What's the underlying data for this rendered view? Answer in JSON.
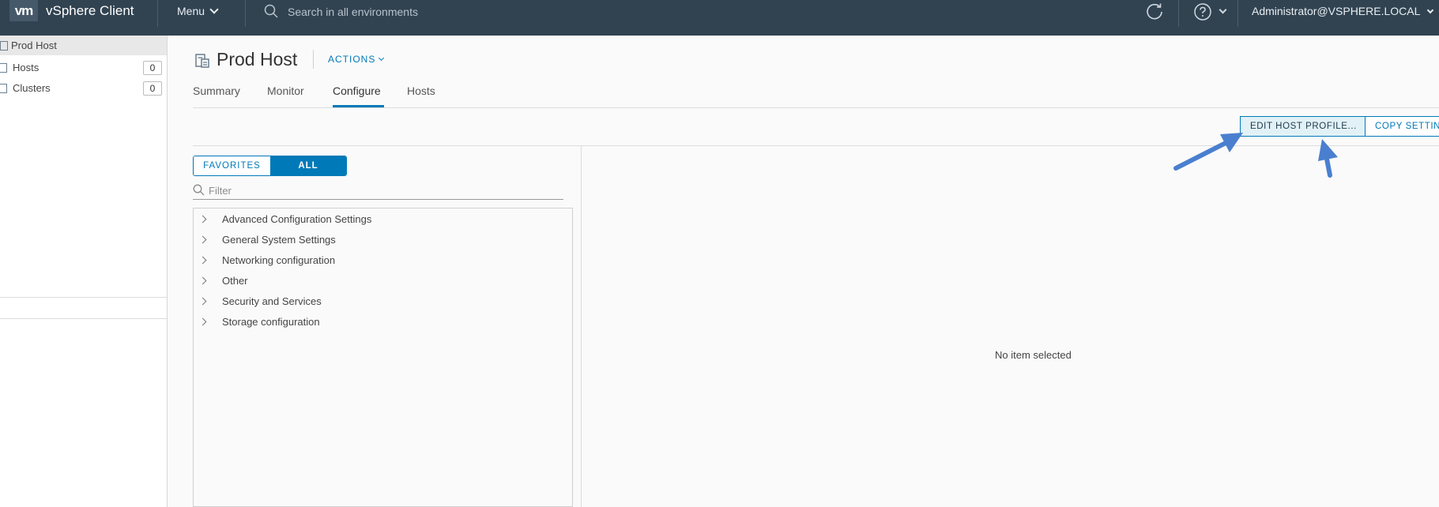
{
  "header": {
    "logo": "vm",
    "app_title": "vSphere Client",
    "menu_label": "Menu",
    "search_placeholder": "Search in all environments",
    "user_label": "Administrator@VSPHERE.LOCAL"
  },
  "navigator": {
    "root_label": "Prod Host",
    "items": [
      {
        "label": "Hosts",
        "count": "0"
      },
      {
        "label": "Clusters",
        "count": "0"
      }
    ]
  },
  "page": {
    "title": "Prod Host",
    "actions_label": "ACTIONS",
    "tabs": [
      {
        "label": "Summary"
      },
      {
        "label": "Monitor"
      },
      {
        "label": "Configure"
      },
      {
        "label": "Hosts"
      }
    ],
    "active_tab": "Configure"
  },
  "toolbar": {
    "edit_host_profile": "EDIT HOST PROFILE...",
    "copy_settings": "COPY SETTIN"
  },
  "settings_panel": {
    "favorites_label": "FAVORITES",
    "all_label": "ALL",
    "filter_placeholder": "Filter",
    "tree_items": [
      {
        "label": "Advanced Configuration Settings"
      },
      {
        "label": "General System Settings"
      },
      {
        "label": "Networking configuration"
      },
      {
        "label": "Other"
      },
      {
        "label": "Security and Services"
      },
      {
        "label": "Storage configuration"
      }
    ]
  },
  "detail_panel": {
    "empty_message": "No item selected"
  },
  "colors": {
    "header_bg": "#314351",
    "accent": "#0079b8",
    "annotation_arrow": "#4a7fcf"
  },
  "icons": [
    "search-icon",
    "refresh-icon",
    "help-icon",
    "host-profile-icon",
    "chevron-right-icon",
    "filter-search-icon"
  ]
}
